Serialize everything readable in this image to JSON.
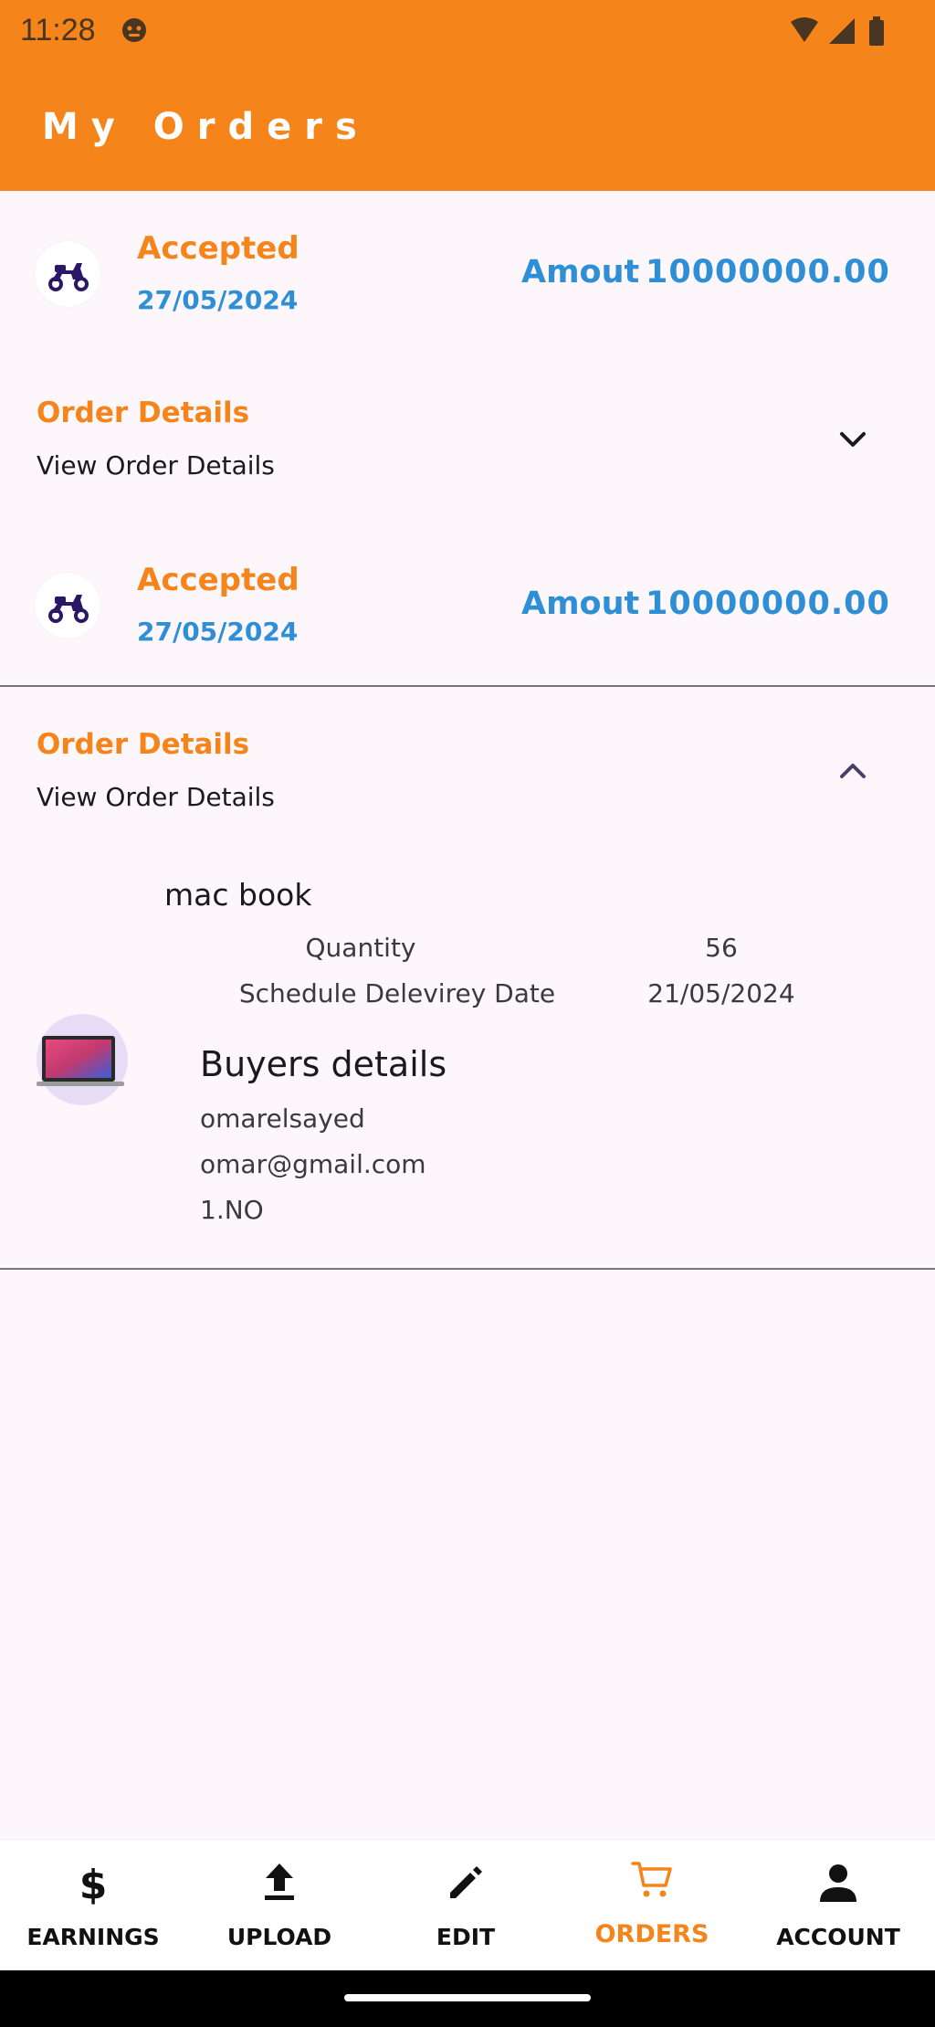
{
  "status_bar": {
    "time": "11:28"
  },
  "app_bar": {
    "title": "My Orders"
  },
  "orders": [
    {
      "status": "Accepted",
      "date": "27/05/2024",
      "amount_label": "Amout",
      "amount": "10000000.00",
      "details_title": "Order Details",
      "details_sub": "View Order Details",
      "expanded": false
    },
    {
      "status": "Accepted",
      "date": "27/05/2024",
      "amount_label": "Amout",
      "amount": "10000000.00",
      "details_title": "Order Details",
      "details_sub": "View Order Details",
      "expanded": true,
      "product": {
        "name": "mac book",
        "quantity_label": "Quantity",
        "quantity": "56",
        "delivery_label": "Schedule Delevirey Date",
        "delivery_date": "21/05/2024"
      },
      "buyer": {
        "title": "Buyers details",
        "name": "omarelsayed",
        "email": "omar@gmail.com",
        "phone": "1.NO"
      }
    }
  ],
  "bottom_nav": {
    "items": [
      {
        "label": "EARNINGS",
        "icon": "dollar-icon"
      },
      {
        "label": "UPLOAD",
        "icon": "upload-icon"
      },
      {
        "label": "EDIT",
        "icon": "pencil-icon"
      },
      {
        "label": "ORDERS",
        "icon": "cart-icon",
        "active": true
      },
      {
        "label": "ACCOUNT",
        "icon": "person-icon"
      }
    ]
  },
  "colors": {
    "accent": "#f5841a",
    "link": "#2e8fd6",
    "background": "#fdf7fc",
    "scooter": "#2b1766"
  }
}
